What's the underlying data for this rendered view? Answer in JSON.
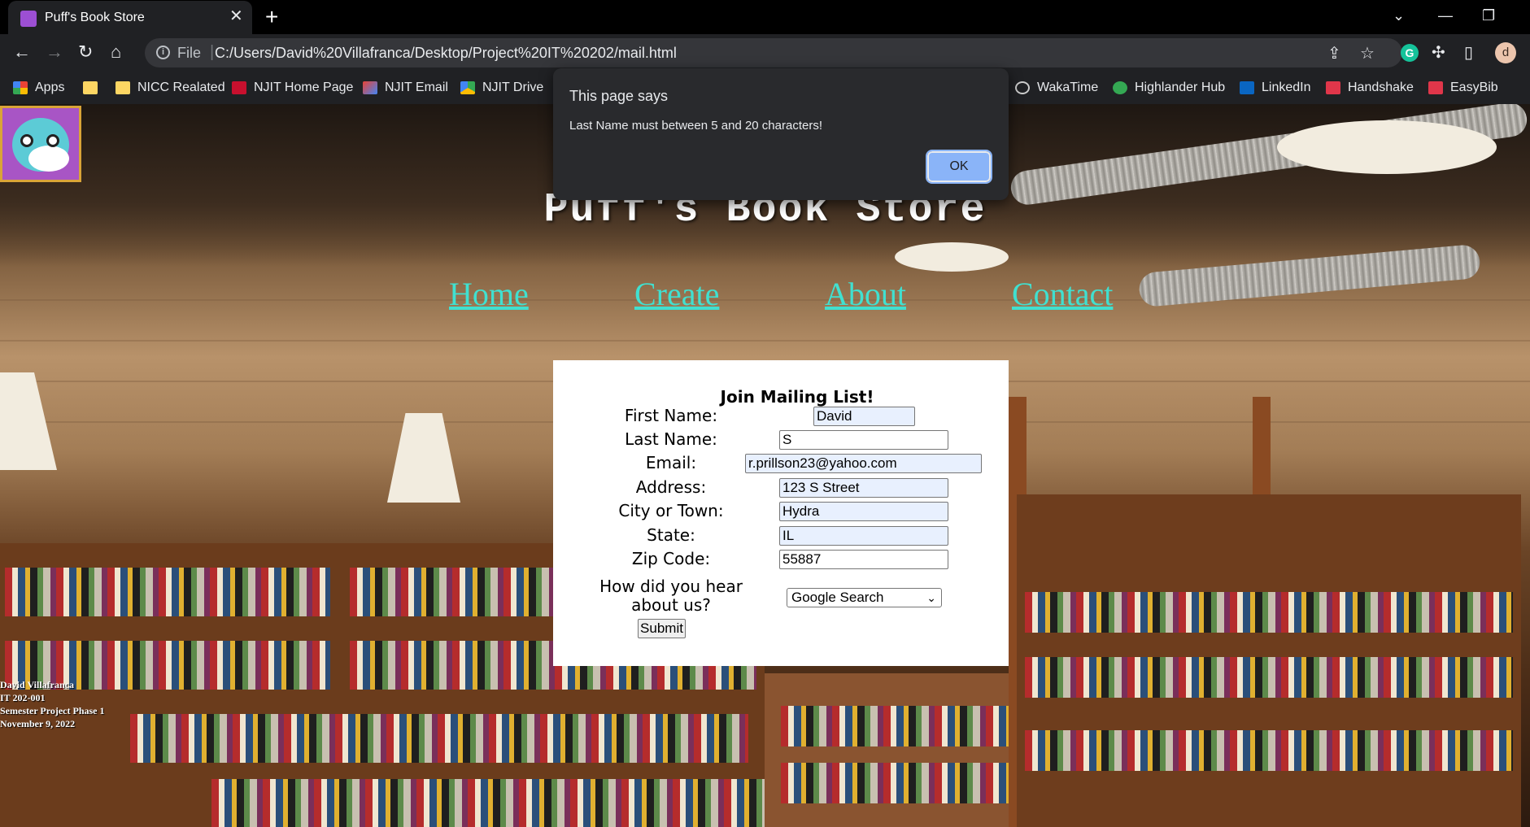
{
  "browser": {
    "tab_title": "Puff's Book Store",
    "tab_close": "✕",
    "new_tab": "+",
    "scheme": "File",
    "url": "C:/Users/David%20Villafranca/Desktop/Project%20IT%20202/mail.html",
    "profile_initial": "d",
    "bookmarks": [
      {
        "label": "Apps",
        "color": "#ea4335"
      },
      {
        "label": "",
        "color": "#fdd663"
      },
      {
        "label": "NICC Realated",
        "color": "#fdd663"
      },
      {
        "label": "NJIT Home Page",
        "color": "#c8102e"
      },
      {
        "label": "NJIT Email",
        "color": "#ea4335"
      },
      {
        "label": "NJIT Drive",
        "color": "#34a853"
      },
      {
        "label": "WakaTime",
        "color": "#cccccc"
      },
      {
        "label": "Highlander Hub",
        "color": "#34a853"
      },
      {
        "label": "LinkedIn",
        "color": "#0a66c2"
      },
      {
        "label": "Handshake",
        "color": "#e0364a"
      },
      {
        "label": "EasyBib",
        "color": "#e0364a"
      }
    ]
  },
  "page": {
    "site_title": "Puff's Book Store",
    "nav": [
      "Home",
      "Create",
      "About",
      "Contact"
    ],
    "form": {
      "title": "Join Mailing List!",
      "fields": [
        {
          "label": "First Name:",
          "value": "David"
        },
        {
          "label": "Last Name:",
          "value": "S"
        },
        {
          "label": "Email:",
          "value": "r.prillson23@yahoo.com"
        },
        {
          "label": "Address:",
          "value": "123 S Street"
        },
        {
          "label": "City or Town:",
          "value": "Hydra"
        },
        {
          "label": "State:",
          "value": "IL"
        },
        {
          "label": "Zip Code:",
          "value": "55887"
        }
      ],
      "hear_label_line1": "How did you hear",
      "hear_label_line2": "about us?",
      "hear_selected": "Google Search",
      "submit_label": "Submit"
    },
    "credits": [
      "David Villafranca",
      "IT 202-001",
      "Semester Project Phase 1",
      "November 9, 2022"
    ]
  },
  "dialog": {
    "title": "This page says",
    "message": "Last Name must between 5 and 20 characters!",
    "ok_label": "OK"
  }
}
